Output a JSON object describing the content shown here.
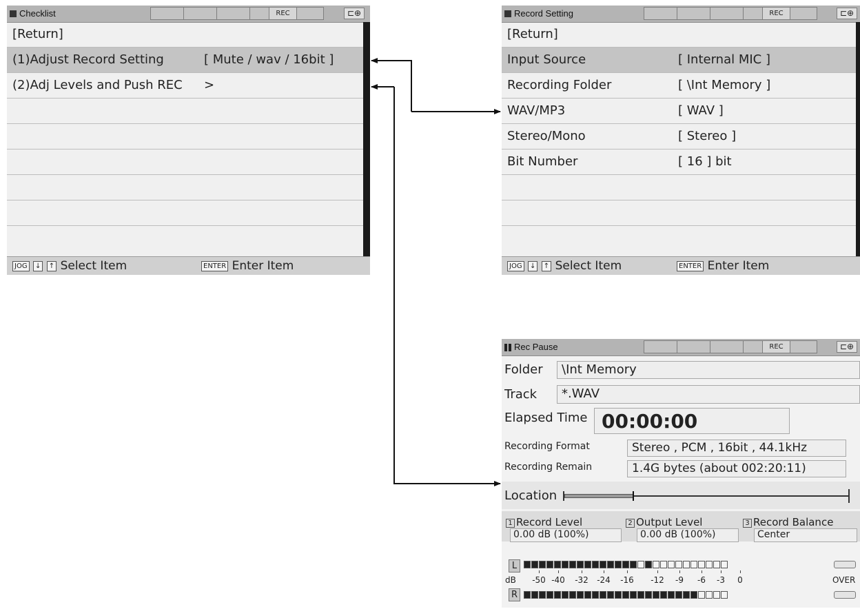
{
  "checklist": {
    "title": "Checklist",
    "rec": "REC",
    "plug": "⊏⊕",
    "rows": [
      {
        "label": "[Return]",
        "value": ""
      },
      {
        "label": "(1)Adjust Record Setting",
        "value": "[ Mute / wav / 16bit    ]"
      },
      {
        "label": "(2)Adj Levels and Push REC",
        "value": ">"
      }
    ],
    "footer": {
      "jog": "JOG",
      "down": "↓",
      "up": "↑",
      "select": "Select Item",
      "enter_key": "ENTER",
      "enter": "Enter Item"
    }
  },
  "record_setting": {
    "title": "Record Setting",
    "rec": "REC",
    "plug": "⊏⊕",
    "rows": [
      {
        "label": "[Return]",
        "value": ""
      },
      {
        "label": "Input Source",
        "value": "[ Internal MIC ]"
      },
      {
        "label": "Recording Folder",
        "value": "[ \\Int Memory ]"
      },
      {
        "label": "WAV/MP3",
        "value": "[ WAV ]"
      },
      {
        "label": "Stereo/Mono",
        "value": "[ Stereo ]"
      },
      {
        "label": "Bit Number",
        "value": "[ 16 ] bit"
      }
    ],
    "footer": {
      "jog": "JOG",
      "down": "↓",
      "up": "↑",
      "select": "Select Item",
      "enter_key": "ENTER",
      "enter": "Enter Item"
    }
  },
  "rec_pause": {
    "title": "Rec Pause",
    "rec": "REC",
    "plug": "⊏⊕",
    "folder_label": "Folder",
    "folder_value": "\\Int Memory",
    "track_label": "Track",
    "track_value": "*.WAV",
    "elapsed_label": "Elapsed Time",
    "elapsed_value": "00:00:00",
    "format_label": "Recording Format",
    "format_value": "Stereo , PCM , 16bit , 44.1kHz",
    "remain_label": "Recording Remain",
    "remain_value": "1.4G bytes (about 002:20:11)",
    "location_label": "Location",
    "levels": [
      {
        "num": "1",
        "label": "Record Level",
        "value": "0.00 dB (100%)"
      },
      {
        "num": "2",
        "label": "Output Level",
        "value": "0.00 dB (100%)"
      },
      {
        "num": "3",
        "label": "Record Balance",
        "value": "Center"
      }
    ],
    "meter_left_label": "L",
    "meter_right_label": "R",
    "db_label": "dB",
    "scale": [
      "-50",
      "-40",
      "-32",
      "-24",
      "-16",
      "-12",
      "-9",
      "-6",
      "-3",
      "0"
    ],
    "over_label": "OVER",
    "meter_segments": 27,
    "left_lit": 15,
    "right_lit": 23,
    "meter_peak_segment": 16
  }
}
